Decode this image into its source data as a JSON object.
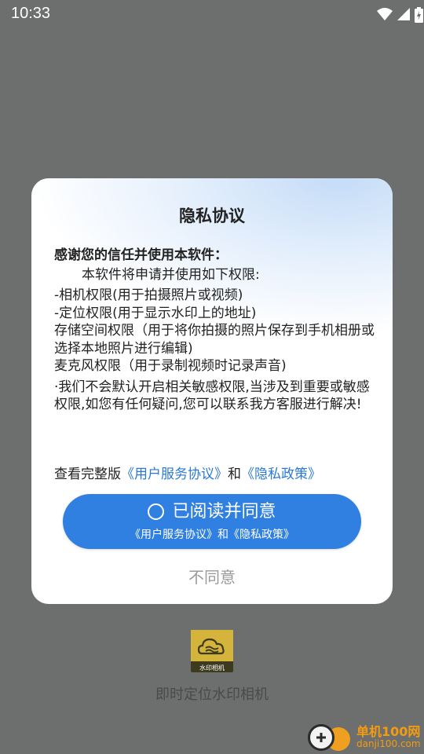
{
  "status_bar": {
    "time": "10:33",
    "icons": [
      "wifi-icon",
      "signal-icon",
      "battery-icon"
    ]
  },
  "dialog": {
    "title": "隐私协议",
    "lead": "感谢您的信任并使用本软件：",
    "intro": "本软件将申请并使用如下权限:",
    "permissions": [
      "-相机权限(用于拍摄照片或视频)",
      "-定位权限(用于显示水印上的地址)",
      "存储空间权限（用于将你拍摄的照片保存到手机相册或选择本地照片进行编辑)",
      "麦克风权限（用于录制视频时记录声音)"
    ],
    "note": "·我们不会默认开启相关敏感权限,当涉及到重要或敏感权限,如您有任何疑问,您可以联系我方客服进行解决!",
    "links_prefix": "查看完整版",
    "link_user_agreement": "《用户服务协议》",
    "links_and": "和",
    "link_privacy_policy": "《隐私政策》",
    "agree_label": "已阅读并同意",
    "agree_sub": "《用户服务协议》和《隐私政策》",
    "disagree_label": "不同意"
  },
  "app": {
    "logo_text": "水印相机",
    "name": "即时定位水印相机"
  },
  "watermark": {
    "line1": "单机100网",
    "line2": "danji100.com"
  },
  "colors": {
    "accent": "#2f80e0",
    "link": "#2a79d6",
    "overlay": "#6d6e6e"
  }
}
